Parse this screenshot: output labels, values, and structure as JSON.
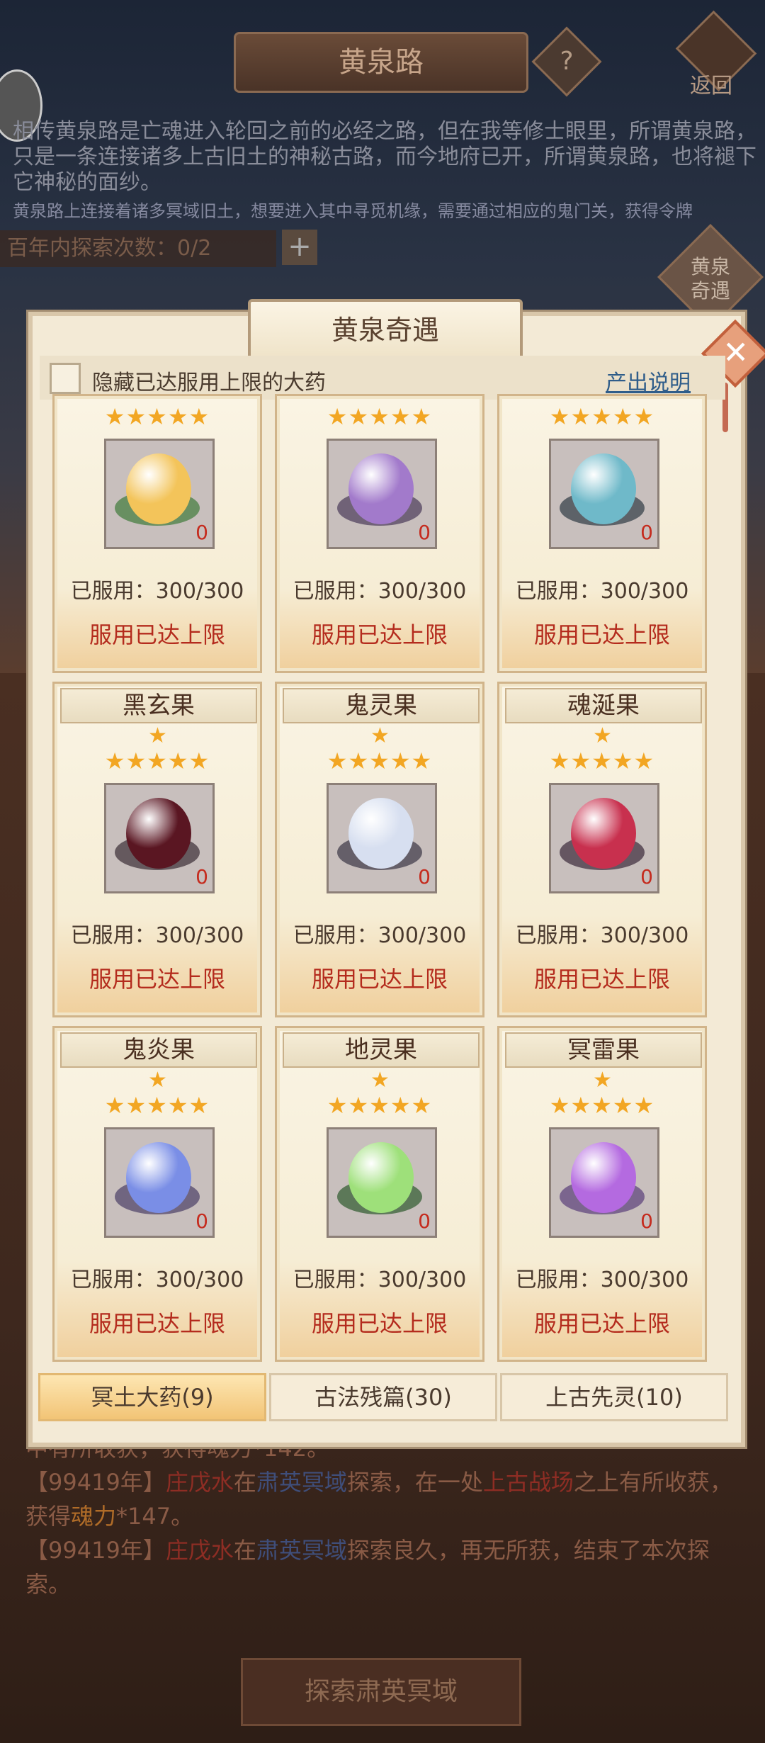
{
  "page": {
    "title": "黄泉路",
    "help": "?",
    "back": "返回",
    "intro": "相传黄泉路是亡魂进入轮回之前的必经之路，但在我等修士眼里，所谓黄泉路，只是一条连接诸多上古旧土的神秘古路，而今地府已开，所谓黄泉路，也将褪下它神秘的面纱。",
    "intro2": "黄泉路上连接着诸多冥域旧土，想要进入其中寻觅机缘，需要通过相应的鬼门关，获得令牌",
    "explore_count": "百年内探索次数：0/2",
    "plus": "+",
    "encounter_btn": "黄泉奇遇",
    "log": {
      "line0": "中有所收获，获得魂力*142。",
      "line1_year": "【99419年】",
      "line1_name": "庄戊水",
      "line1_in": "在",
      "line1_place": "肃英冥域",
      "line1_mid": "探索，在一处",
      "line1_site": "上古战场",
      "line1_end": "之上有所收获，获得",
      "line1_item": "魂力",
      "line1_qty": "*147。",
      "line2_year": "【99419年】",
      "line2_name": "庄戊水",
      "line2_in": "在",
      "line2_place": "肃英冥域",
      "line2_end": "探索良久，再无所获，结束了本次探索。"
    },
    "explore_button": "探索肃英冥域"
  },
  "modal": {
    "title": "黄泉奇遇",
    "close": "✕",
    "filter_label": "隐藏已达服用上限的大药",
    "explain_link": "产出说明",
    "tabs": [
      "冥土大药(9)",
      "古法残篇(30)",
      "上古先灵(10)"
    ],
    "active_tab": 0
  },
  "cards": [
    {
      "name": "",
      "stars": "★★★★★",
      "top_star": "",
      "count": "0",
      "used": "已服用：300/300",
      "status": "服用已达上限",
      "color": "#f3c45a",
      "leaf": "#3f7a3a"
    },
    {
      "name": "",
      "stars": "★★★★★",
      "top_star": "",
      "count": "0",
      "used": "已服用：300/300",
      "status": "服用已达上限",
      "color": "#a27acb",
      "leaf": "#4a3a5a"
    },
    {
      "name": "",
      "stars": "★★★★★",
      "top_star": "",
      "count": "0",
      "used": "已服用：300/300",
      "status": "服用已达上限",
      "color": "#6fb9c9",
      "leaf": "#2f3a44"
    },
    {
      "name": "黑玄果",
      "stars": "★★★★★",
      "top_star": "★",
      "count": "0",
      "used": "已服用：300/300",
      "status": "服用已达上限",
      "color": "#5a1622",
      "leaf": "#3a2e36"
    },
    {
      "name": "鬼灵果",
      "stars": "★★★★★",
      "top_star": "★",
      "count": "0",
      "used": "已服用：300/300",
      "status": "服用已达上限",
      "color": "#d7dff0",
      "leaf": "#3a3646"
    },
    {
      "name": "魂涎果",
      "stars": "★★★★★",
      "top_star": "★",
      "count": "0",
      "used": "已服用：300/300",
      "status": "服用已达上限",
      "color": "#c8304e",
      "leaf": "#3a2a3a"
    },
    {
      "name": "鬼炎果",
      "stars": "★★★★★",
      "top_star": "★",
      "count": "0",
      "used": "已服用：300/300",
      "status": "服用已达上限",
      "color": "#7a8ee6",
      "leaf": "#4a3e66"
    },
    {
      "name": "地灵果",
      "stars": "★★★★★",
      "top_star": "★",
      "count": "0",
      "used": "已服用：300/300",
      "status": "服用已达上限",
      "color": "#9ee07a",
      "leaf": "#2e5a2e"
    },
    {
      "name": "冥雷果",
      "stars": "★★★★★",
      "top_star": "★",
      "count": "0",
      "used": "已服用：300/300",
      "status": "服用已达上限",
      "color": "#b46ae0",
      "leaf": "#5a3e7a"
    }
  ]
}
